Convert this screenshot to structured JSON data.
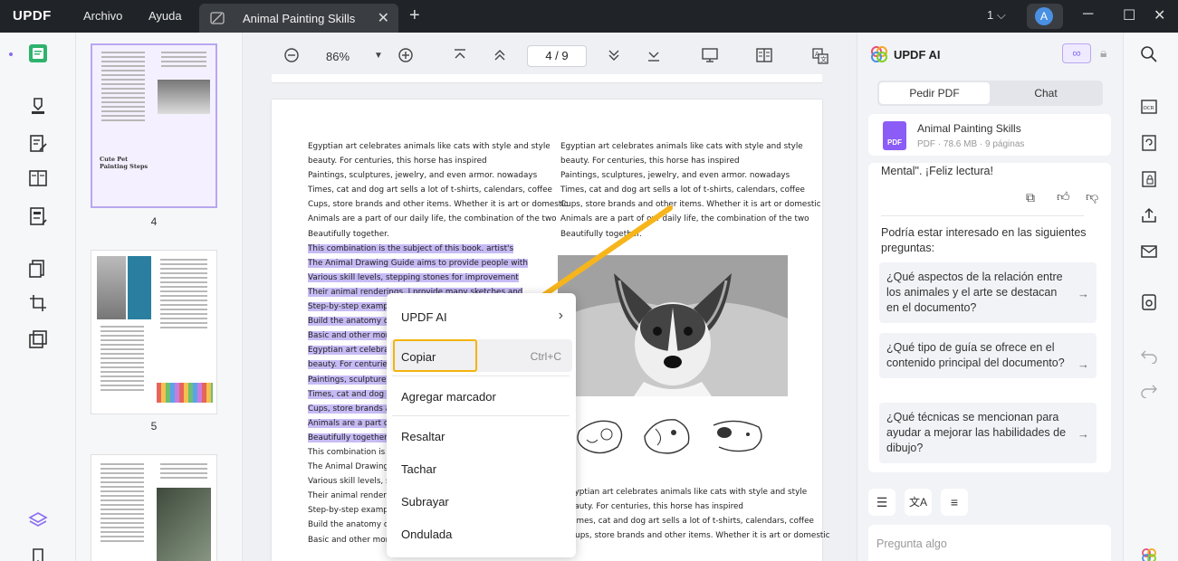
{
  "app": {
    "logo": "UPDF",
    "menu": [
      "Archivo",
      "Ayuda"
    ],
    "tab_title": "Animal Painting Skills",
    "window_count": "1",
    "avatar_letter": "A"
  },
  "toolbar": {
    "zoom": "86%",
    "page_current": "4",
    "page_total": "9",
    "page_display": "4 / 9"
  },
  "thumbnails": {
    "page4_heading": "Cute Pet Painting Steps",
    "labels": [
      "4",
      "5"
    ]
  },
  "document": {
    "left_column": [
      {
        "text": "Egyptian art celebrates animals like cats with style and style",
        "hl": false
      },
      {
        "text": "beauty. For centuries, this horse has inspired",
        "hl": false
      },
      {
        "text": "Paintings, sculptures, jewelry, and even armor. nowadays",
        "hl": false
      },
      {
        "text": "Times, cat and dog art sells a lot of t-shirts, calendars, coffee",
        "hl": false
      },
      {
        "text": "Cups, store brands and other items. Whether it is art or domestic",
        "hl": false
      },
      {
        "text": "Animals are a part of our daily life, the combination of the two",
        "hl": false
      },
      {
        "text": "Beautifully together.",
        "hl": false
      },
      {
        "text": "This combination is the subject of this book. artist's",
        "hl": true
      },
      {
        "text": "The Animal Drawing Guide aims to provide people with",
        "hl": true
      },
      {
        "text": "Various skill levels, stepping stones for improvement",
        "hl": true
      },
      {
        "text": "Their animal renderings. I provide many sketches and",
        "hl": true
      },
      {
        "text": "Step-by-step examples",
        "hl": true
      },
      {
        "text": "Build the anatomy of a",
        "hl": true
      },
      {
        "text": "Basic and other more",
        "hl": true
      },
      {
        "text": "Egyptian art celebrate",
        "hl": true
      },
      {
        "text": "beauty. For centuries,",
        "hl": true
      },
      {
        "text": "Paintings, sculptures,",
        "hl": true
      },
      {
        "text": "Times, cat and dog art",
        "hl": true
      },
      {
        "text": "Cups, store brands and",
        "hl": true
      },
      {
        "text": "Animals are a part of",
        "hl": true
      },
      {
        "text": "Beautifully together.",
        "hl": true
      },
      {
        "text": "This combination is th",
        "hl": false
      },
      {
        "text": "The Animal Drawing Gu",
        "hl": false
      },
      {
        "text": "Various skill levels, st",
        "hl": false
      },
      {
        "text": "Their animal rendering",
        "hl": false
      },
      {
        "text": "Step-by-step examples",
        "hl": false
      },
      {
        "text": "Build the anatomy of a",
        "hl": false
      },
      {
        "text": "Basic and other more",
        "hl": false
      }
    ],
    "right_column_top": [
      "Egyptian art celebrates animals like cats with style and style",
      "beauty. For centuries, this horse has inspired",
      "Paintings, sculptures, jewelry, and even armor. nowadays",
      "Times, cat and dog art sells a lot of t-shirts, calendars, coffee",
      "Cups, store brands and other items. Whether it is art or domestic",
      "Animals are a part of our daily life, the combination of the two",
      "Beautifully together."
    ],
    "right_column_bottom": [
      "gyptian art celebrates animals like cats with style and style",
      "eauty. For centuries, this horse has inspired",
      "Times, cat and dog art sells a lot of t-shirts, calendars, coffee",
      "Cups, store brands and other items. Whether it is art or domestic"
    ]
  },
  "context_menu": {
    "updf_ai": "UPDF AI",
    "copy": "Copiar",
    "copy_shortcut": "Ctrl+C",
    "bookmark": "Agregar marcador",
    "highlight": "Resaltar",
    "strike": "Tachar",
    "underline": "Subrayar",
    "wavy": "Ondulada"
  },
  "ai_panel": {
    "title": "UPDF AI",
    "tabs": [
      "Pedir PDF",
      "Chat"
    ],
    "file_name": "Animal Painting Skills",
    "file_meta": "PDF · 78.6 MB · 9 páginas",
    "file_badge": "PDF",
    "message_tail": "Mental\". ¡Feliz lectura!",
    "suggest_heading": "Podría estar interesado en las siguientes preguntas:",
    "questions": [
      "¿Qué aspectos de la relación entre los animales y el arte se destacan en el documento?",
      "¿Qué tipo de guía se ofrece en el contenido principal del documento?",
      "¿Qué técnicas se mencionan para ayudar a mejorar las habilidades de dibujo?"
    ],
    "input_placeholder": "Pregunta algo"
  },
  "colors": {
    "highlight": "#c7bbf5",
    "accent_purple": "#8b6cf0",
    "copy_outline": "#f3b40c",
    "titlebar": "#202327"
  }
}
